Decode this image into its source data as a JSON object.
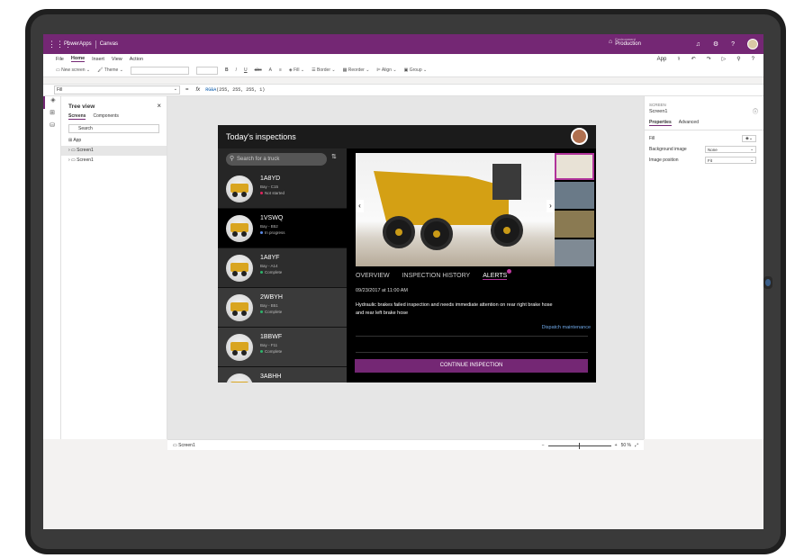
{
  "topbar": {
    "app_name": "PowerApps",
    "crumb": "Canvas",
    "env_label": "Environment",
    "env_value": "Production"
  },
  "menu": {
    "items": [
      "File",
      "Home",
      "Insert",
      "View",
      "Action"
    ],
    "right_label": "App"
  },
  "ribbon": {
    "new_screen": "New screen",
    "theme": "Theme",
    "bold": "B",
    "italic": "/",
    "underline": "U",
    "strike": "abc",
    "font_size": "A",
    "align": "≡",
    "fill": "Fill",
    "border": "Border",
    "reorder": "Reorder",
    "align_btn": "Align",
    "group": "Group"
  },
  "formula": {
    "property": "Fill",
    "equals": "=",
    "fx": "fx",
    "value_fn": "RGBA",
    "value_args": "(255, 255, 255, 1)"
  },
  "tree": {
    "title": "Tree view",
    "tab_screens": "Screens",
    "tab_components": "Components",
    "search_placeholder": "Search",
    "app_item": "App",
    "items": [
      "Screen1",
      "Screen1"
    ]
  },
  "status": {
    "screen": "Screen1",
    "zoom_minus": "−",
    "zoom_plus": "+",
    "zoom_value": "50 %"
  },
  "props": {
    "caption": "SCREEN",
    "name": "Screen1",
    "tab_properties": "Properties",
    "tab_advanced": "Advanced",
    "fill_label": "Fill",
    "bg_label": "Background image",
    "bg_value": "None",
    "pos_label": "Image position",
    "pos_value": "Fit"
  },
  "app": {
    "title": "Today's inspections",
    "search_placeholder": "Search for a truck",
    "trucks": [
      {
        "id": "1A8YD",
        "bay": "Bay - C15",
        "status": "Not started",
        "color": "#e0245e"
      },
      {
        "id": "1VSWQ",
        "bay": "Bay - B52",
        "status": "In progress",
        "color": "#5b8ae6"
      },
      {
        "id": "1A8YF",
        "bay": "Bay - A14",
        "status": "Complete",
        "color": "#2fb36b"
      },
      {
        "id": "2WBYH",
        "bay": "Bay - B51",
        "status": "Complete",
        "color": "#2fb36b"
      },
      {
        "id": "1BBWF",
        "bay": "Bay - F11",
        "status": "Complete",
        "color": "#2fb36b"
      },
      {
        "id": "3ABHH",
        "bay": "Bay - B09",
        "status": "",
        "color": "#2fb36b"
      }
    ],
    "tabs": [
      "OVERVIEW",
      "INSPECTION HISTORY",
      "ALERTS"
    ],
    "datetime": "09/23/2017 at 11:00 AM",
    "description": "Hydraulic brakes failed inspection and needs immediate attention on rear right brake hose and rear left brake hose",
    "dispatch": "Dispatch maintenance",
    "continue": "CONTINUE INSPECTION"
  }
}
